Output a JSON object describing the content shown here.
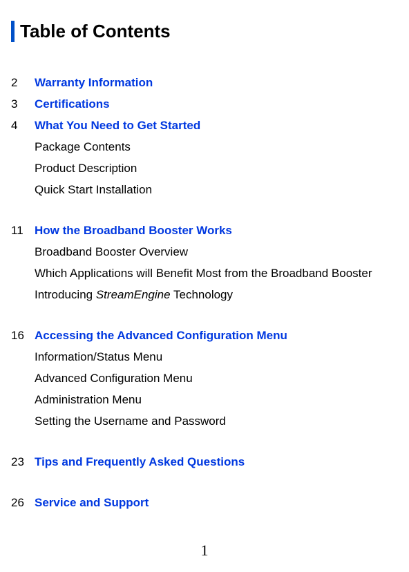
{
  "title": "Table of Contents",
  "page_number": "1",
  "toc": {
    "e1_pg": "2",
    "e1_title": "Warranty Information",
    "e2_pg": "3",
    "e2_title": "Certifications",
    "e3_pg": "4",
    "e3_title": "What You Need to Get Started",
    "e3_s1": "Package Contents",
    "e3_s2": "Product Description",
    "e3_s3": "Quick Start Installation",
    "e4_pg": "11",
    "e4_title": "How the Broadband Booster Works",
    "e4_s1": "Broadband Booster Overview",
    "e4_s2": "Which Applications will Benefit Most from the Broadband Booster",
    "e4_s3_a": "Introducing ",
    "e4_s3_b": "StreamEngine",
    "e4_s3_c": " Technology",
    "e5_pg": "16",
    "e5_title": "Accessing the Advanced Configuration Menu",
    "e5_s1": "Information/Status Menu",
    "e5_s2": "Advanced Configuration Menu",
    "e5_s3": "Administration Menu",
    "e5_s4": "Setting the Username and Password",
    "e6_pg": "23",
    "e6_title": "Tips and Frequently Asked Questions",
    "e7_pg": "26",
    "e7_title": "Service and Support"
  }
}
